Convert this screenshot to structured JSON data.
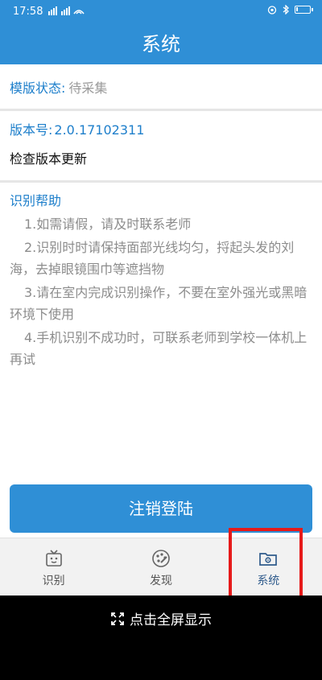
{
  "status": {
    "time": "17:58",
    "signal": "³³|||  ³³|||  ▱",
    "battery_level": 0.15
  },
  "header": {
    "title": "系统"
  },
  "template_status": {
    "label": "模版状态:",
    "value": "待采集"
  },
  "version": {
    "label": "版本号:",
    "value": "2.0.17102311",
    "check_update": "检查版本更新"
  },
  "help": {
    "title": "识别帮助",
    "items": [
      "1.如需请假，请及时联系老师",
      "2.识别时时请保持面部光线均匀，捋起头发的刘海，去掉眼镜围巾等遮挡物",
      "3.请在室内完成识别操作，不要在室外强光或黑暗环境下使用",
      "4.手机识别不成功时，可联系老师到学校一体机上再试"
    ]
  },
  "logout_label": "注销登陆",
  "tabs": [
    {
      "label": "识别",
      "icon": "tv-scan-icon"
    },
    {
      "label": "发现",
      "icon": "palette-icon"
    },
    {
      "label": "系统",
      "icon": "folder-settings-icon",
      "active": true
    }
  ],
  "fullscreen_label": "点击全屏显示",
  "colors": {
    "primary": "#2f8fd6",
    "label_blue": "#1e7fcb",
    "highlight": "#e61a1a"
  }
}
